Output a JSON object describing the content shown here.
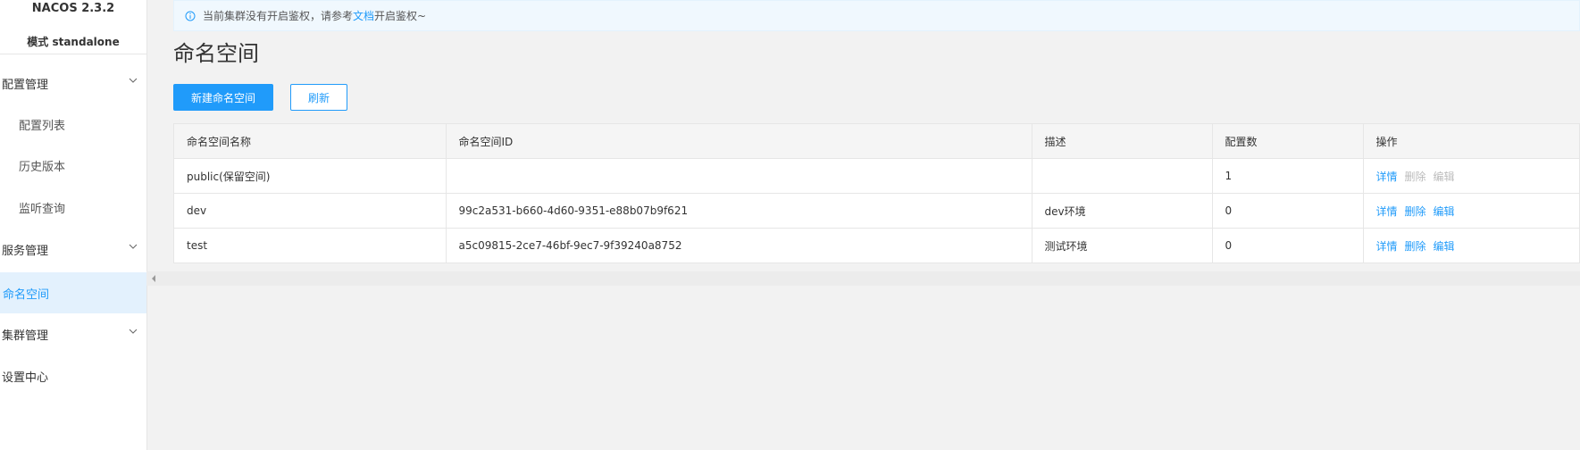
{
  "sidebar": {
    "brand": "NACOS 2.3.2",
    "mode": "模式 standalone",
    "config_group": "配置管理",
    "config_list": "配置列表",
    "history": "历史版本",
    "listen_query": "监听查询",
    "service_group": "服务管理",
    "namespace": "命名空间",
    "cluster_group": "集群管理",
    "settings": "设置中心"
  },
  "alert": {
    "text_before": "当前集群没有开启鉴权，请参考",
    "link": "文档",
    "text_after": "开启鉴权~"
  },
  "page": {
    "title": "命名空间",
    "new_button": "新建命名空间",
    "refresh_button": "刷新"
  },
  "table": {
    "headers": [
      "命名空间名称",
      "命名空间ID",
      "描述",
      "配置数",
      "操作"
    ],
    "rows": [
      {
        "name": "public(保留空间)",
        "id": "",
        "desc": "",
        "count": "1",
        "detail": "详情",
        "delete": "删除",
        "edit": "编辑"
      },
      {
        "name": "dev",
        "id": "99c2a531-b660-4d60-9351-e88b07b9f621",
        "desc": "dev环境",
        "count": "0",
        "detail": "详情",
        "delete": "删除",
        "edit": "编辑"
      },
      {
        "name": "test",
        "id": "a5c09815-2ce7-46bf-9ec7-9f39240a8752",
        "desc": "测试环境",
        "count": "0",
        "detail": "详情",
        "delete": "删除",
        "edit": "编辑"
      }
    ]
  },
  "colors": {
    "accent": "#209bfa",
    "active_bg": "#e3f1fd"
  }
}
